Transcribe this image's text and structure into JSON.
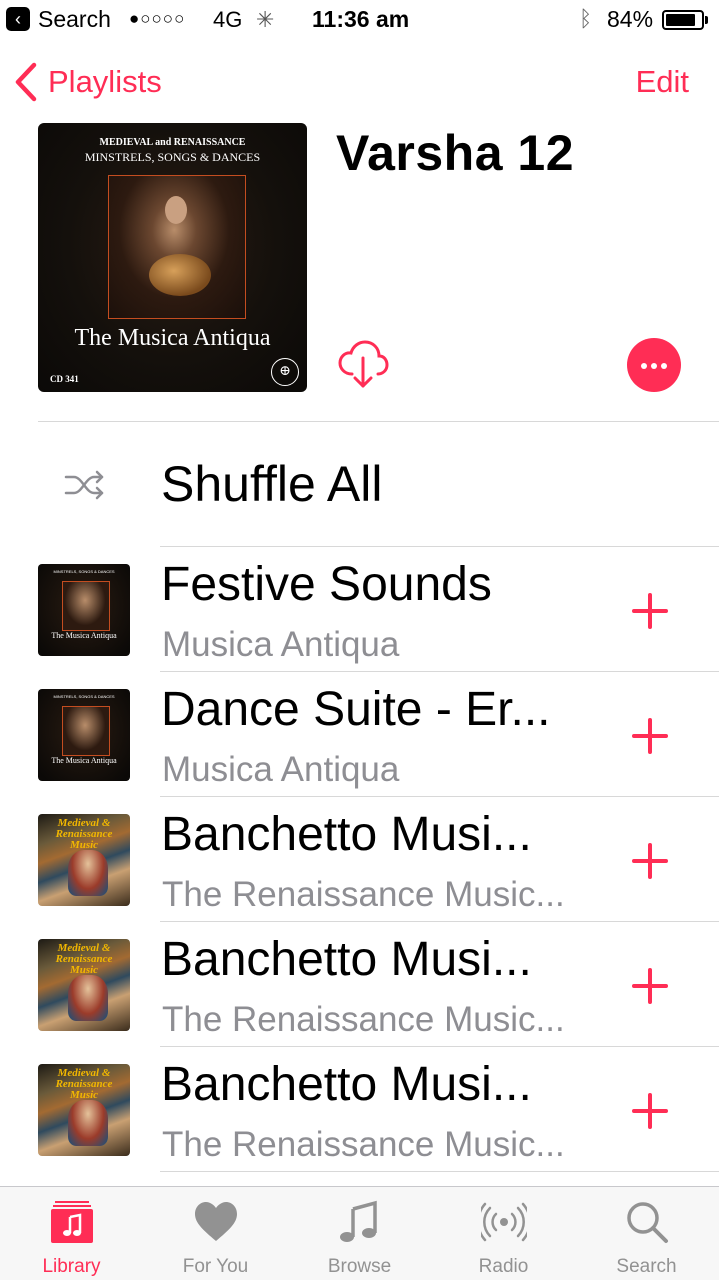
{
  "status_bar": {
    "back_app": "Search",
    "signal_dots": "●○○○○",
    "network": "4G",
    "time": "11:36 am",
    "battery_percent": "84%",
    "battery_level": 0.84
  },
  "nav": {
    "back_label": "Playlists",
    "edit_label": "Edit"
  },
  "artwork": {
    "line1": "MEDIEVAL and RENAISSANCE",
    "line2": "MINSTRELS, SONGS & DANCES",
    "title": "The Musica Antiqua",
    "catalog": "CD 341"
  },
  "playlist": {
    "title": "Varsha 12",
    "shuffle_label": "Shuffle All"
  },
  "songs": [
    {
      "title": "Festive Sounds",
      "artist": "Musica Antiqua",
      "art": "musica"
    },
    {
      "title": "Dance Suite - Er...",
      "artist": "Musica Antiqua",
      "art": "musica"
    },
    {
      "title": "Banchetto Musi...",
      "artist": "The Renaissance Music...",
      "art": "renais"
    },
    {
      "title": "Banchetto Musi...",
      "artist": "The Renaissance Music...",
      "art": "renais"
    },
    {
      "title": "Banchetto Musi...",
      "artist": "The Renaissance Music...",
      "art": "renais"
    }
  ],
  "renaissance_art_text": "Medieval & Renaissance Music",
  "tabs": [
    {
      "label": "Library",
      "icon": "library-icon",
      "active": true
    },
    {
      "label": "For You",
      "icon": "heart-icon",
      "active": false
    },
    {
      "label": "Browse",
      "icon": "music-note-icon",
      "active": false
    },
    {
      "label": "Radio",
      "icon": "radio-icon",
      "active": false
    },
    {
      "label": "Search",
      "icon": "search-icon",
      "active": false
    }
  ],
  "colors": {
    "accent": "#ff2d55",
    "secondary_text": "#8e8e93",
    "separator": "#d8d8d8",
    "tab_inactive": "#929292"
  }
}
